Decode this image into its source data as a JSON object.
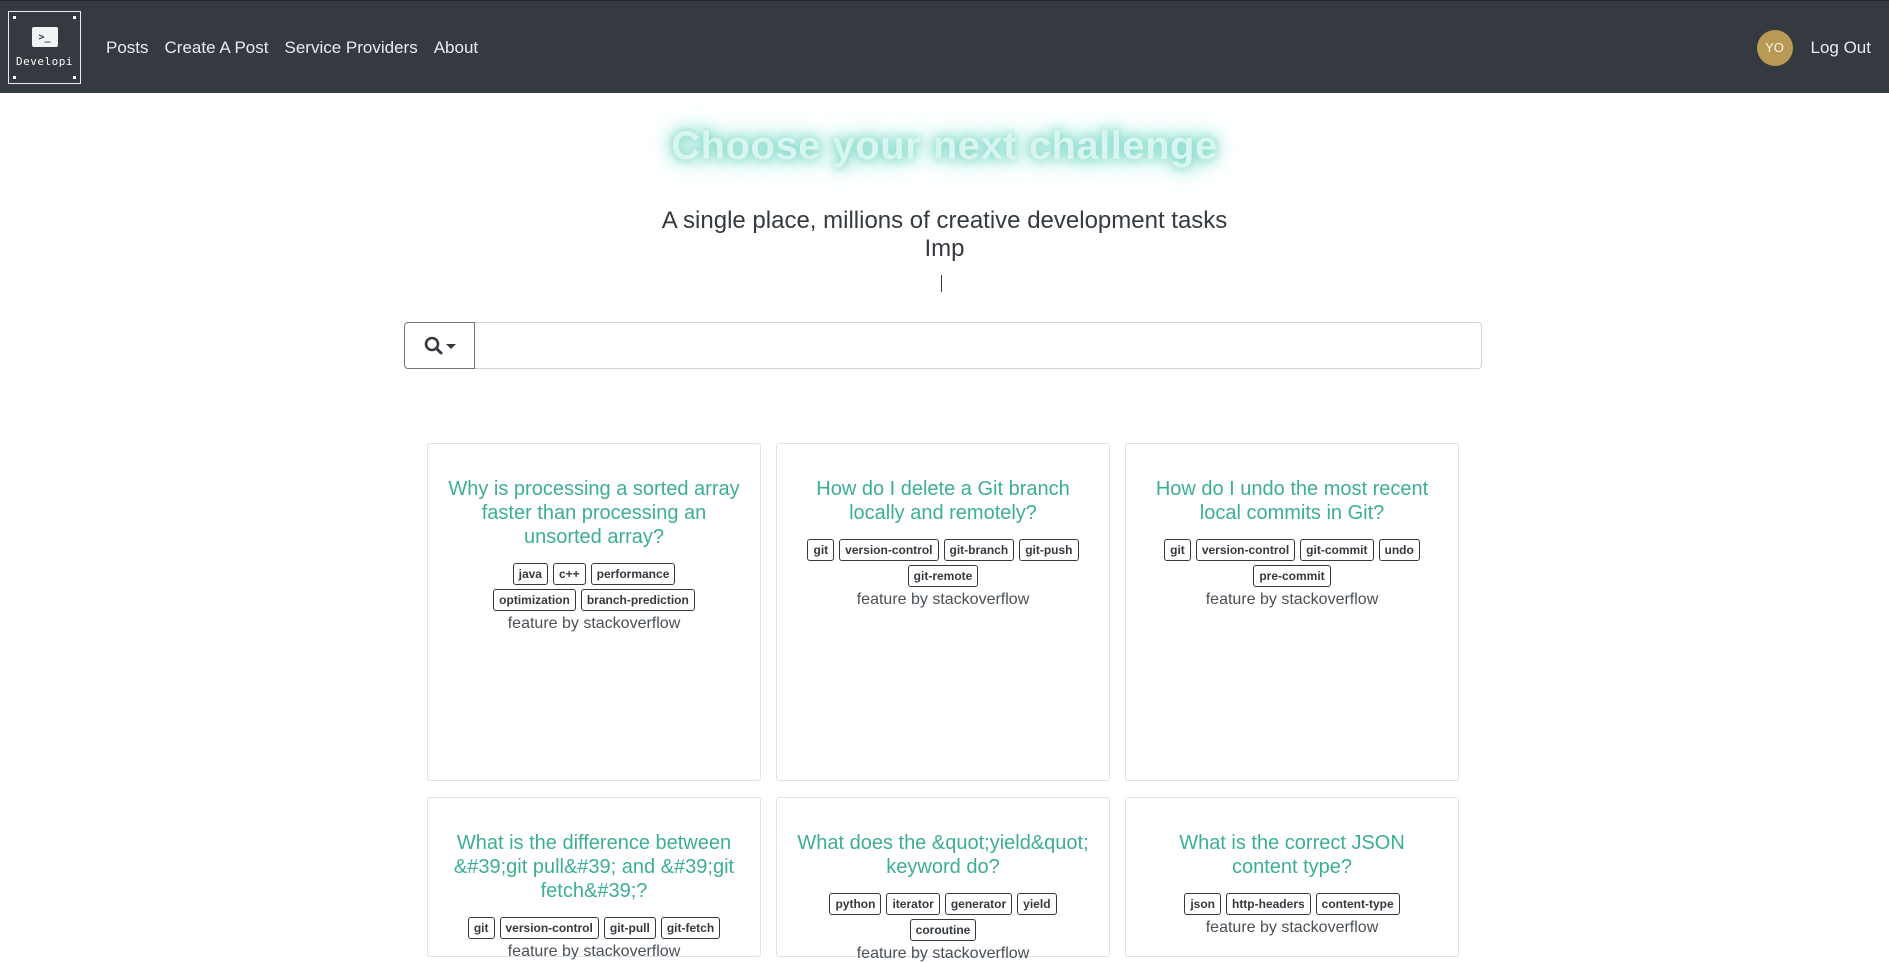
{
  "navbar": {
    "brand_text": "Developi",
    "brand_glyph": ">_",
    "links": [
      "Posts",
      "Create A Post",
      "Service Providers",
      "About"
    ],
    "avatar_initials": "YO",
    "logout_label": "Log Out"
  },
  "hero": {
    "title": "Choose your next challenge",
    "subtitle": "A single place, millions of creative development tasks",
    "typed_text": "Imp"
  },
  "search": {
    "placeholder": "",
    "value": ""
  },
  "colors": {
    "accent": "#3cae97",
    "navbar_bg": "#343a40",
    "avatar_bg": "#b89a55"
  },
  "cards": [
    {
      "title": "Why is processing a sorted array faster than processing an unsorted array?",
      "tags": [
        "java",
        "c++",
        "performance",
        "optimization",
        "branch-prediction"
      ],
      "feature": "feature by stackoverflow"
    },
    {
      "title": "How do I delete a Git branch locally and remotely?",
      "tags": [
        "git",
        "version-control",
        "git-branch",
        "git-push",
        "git-remote"
      ],
      "feature": "feature by stackoverflow"
    },
    {
      "title": "How do I undo the most recent local commits in Git?",
      "tags": [
        "git",
        "version-control",
        "git-commit",
        "undo",
        "pre-commit"
      ],
      "feature": "feature by stackoverflow"
    },
    {
      "title": "What is the difference between &#39;git pull&#39; and &#39;git fetch&#39;?",
      "tags": [
        "git",
        "version-control",
        "git-pull",
        "git-fetch"
      ],
      "feature": "feature by stackoverflow"
    },
    {
      "title": "What does the &quot;yield&quot; keyword do?",
      "tags": [
        "python",
        "iterator",
        "generator",
        "yield",
        "coroutine"
      ],
      "feature": "feature by stackoverflow"
    },
    {
      "title": "What is the correct JSON content type?",
      "tags": [
        "json",
        "http-headers",
        "content-type"
      ],
      "feature": "feature by stackoverflow"
    }
  ]
}
